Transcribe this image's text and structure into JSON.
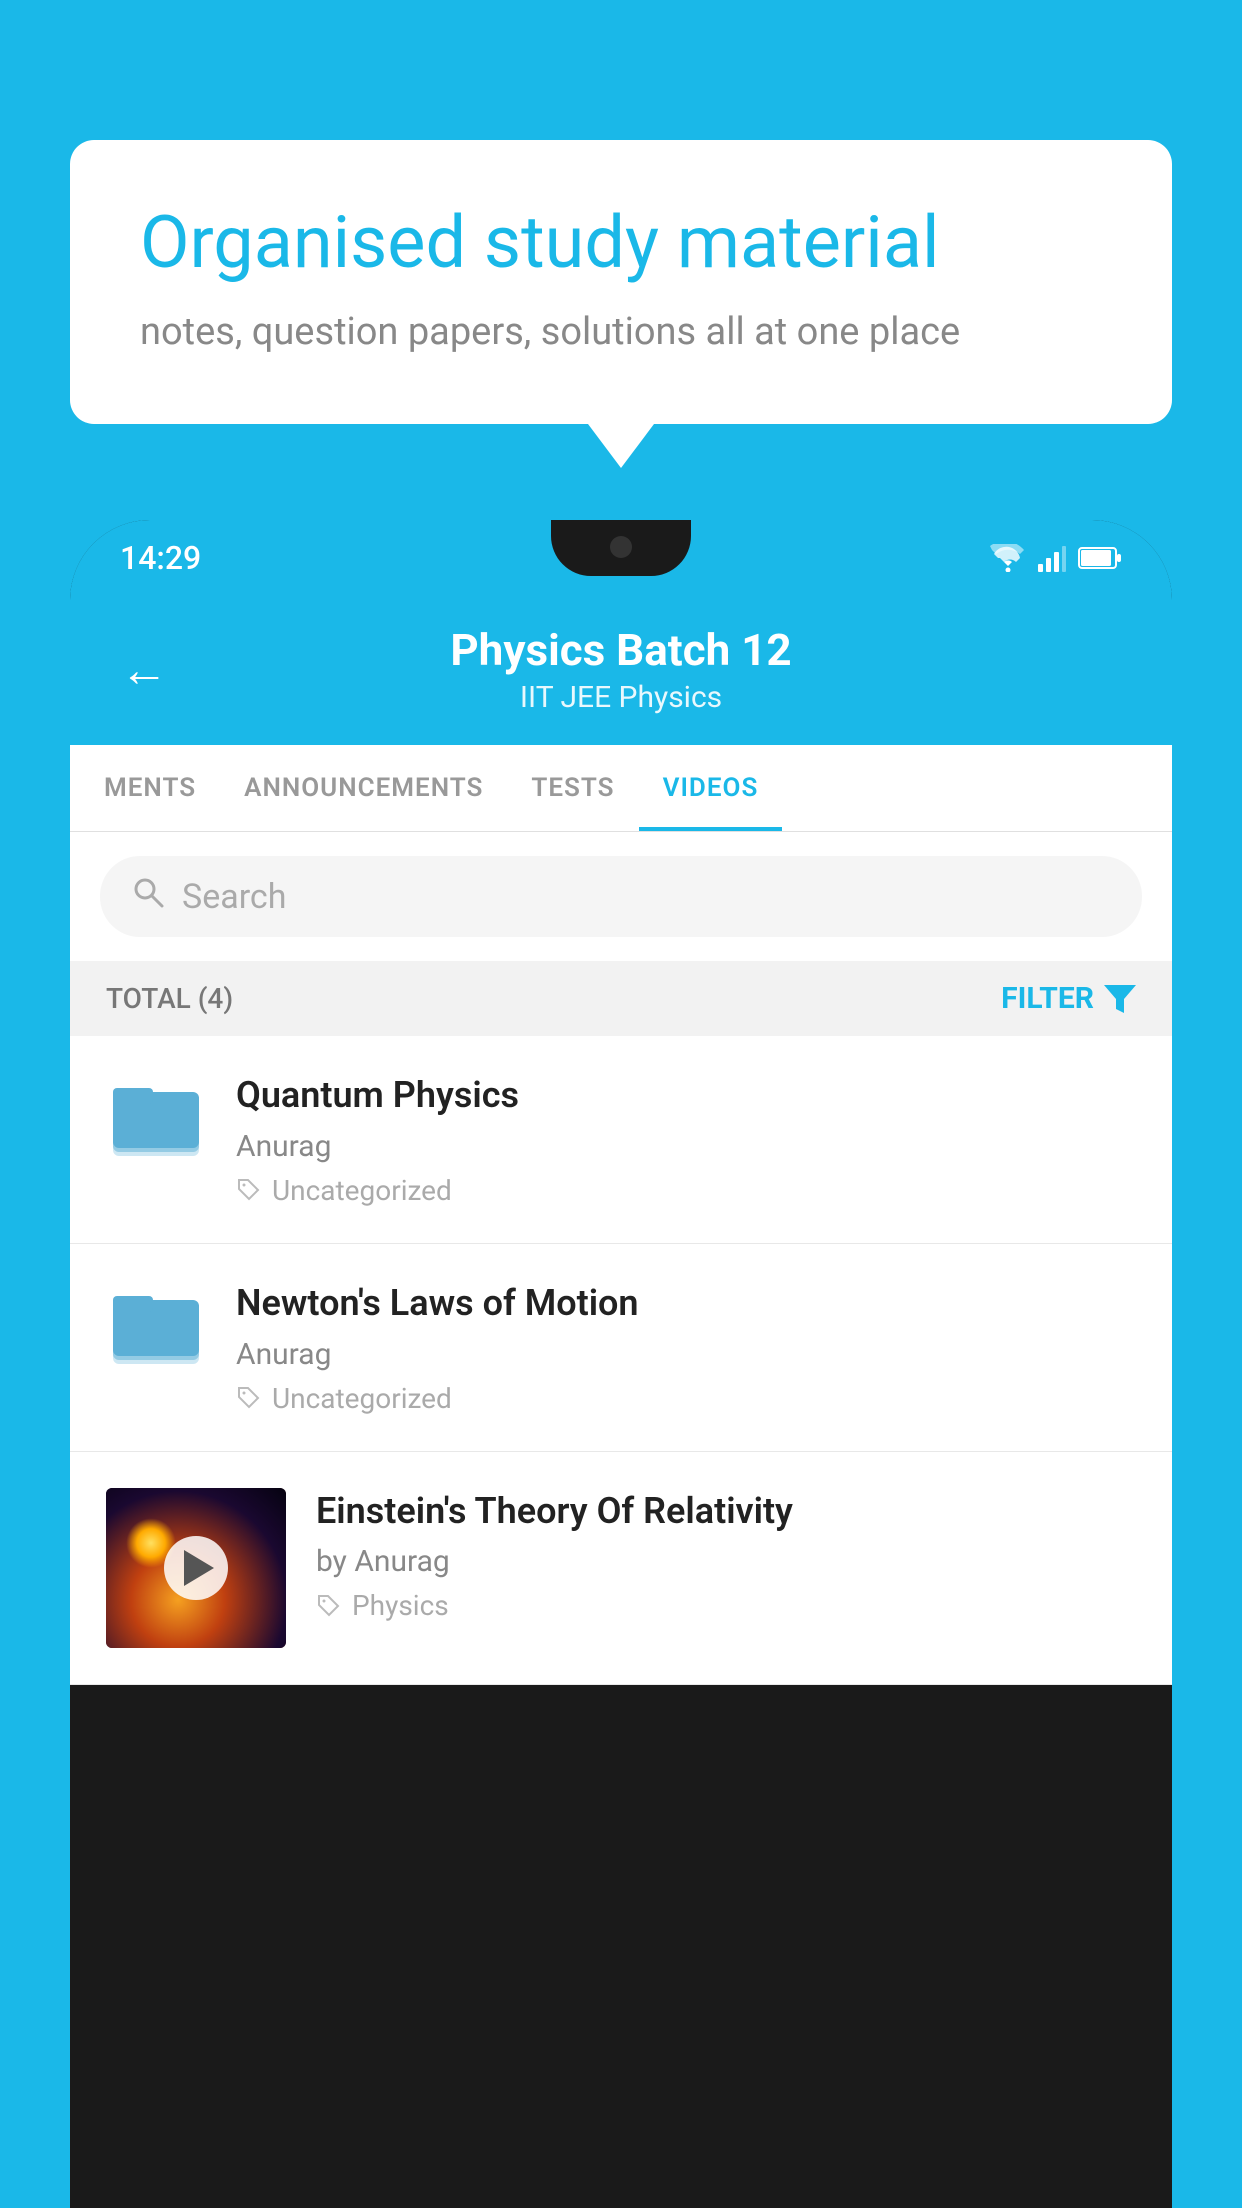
{
  "background_color": "#1ab8e8",
  "speech_bubble": {
    "title": "Organised study material",
    "subtitle": "notes, question papers, solutions all at one place"
  },
  "status_bar": {
    "time": "14:29",
    "wifi": true,
    "signal": true,
    "battery": true
  },
  "app_header": {
    "back_label": "←",
    "title": "Physics Batch 12",
    "subtitle": "IIT JEE   Physics"
  },
  "tabs": [
    {
      "label": "MENTS",
      "active": false
    },
    {
      "label": "ANNOUNCEMENTS",
      "active": false
    },
    {
      "label": "TESTS",
      "active": false
    },
    {
      "label": "VIDEOS",
      "active": true
    }
  ],
  "search": {
    "placeholder": "Search"
  },
  "filter_bar": {
    "total_label": "TOTAL (4)",
    "filter_label": "FILTER"
  },
  "videos": [
    {
      "title": "Quantum Physics",
      "author": "Anurag",
      "tag": "Uncategorized",
      "type": "folder",
      "has_thumb": false
    },
    {
      "title": "Newton's Laws of Motion",
      "author": "Anurag",
      "tag": "Uncategorized",
      "type": "folder",
      "has_thumb": false
    },
    {
      "title": "Einstein's Theory Of Relativity",
      "author": "by Anurag",
      "tag": "Physics",
      "type": "video",
      "has_thumb": true
    }
  ]
}
